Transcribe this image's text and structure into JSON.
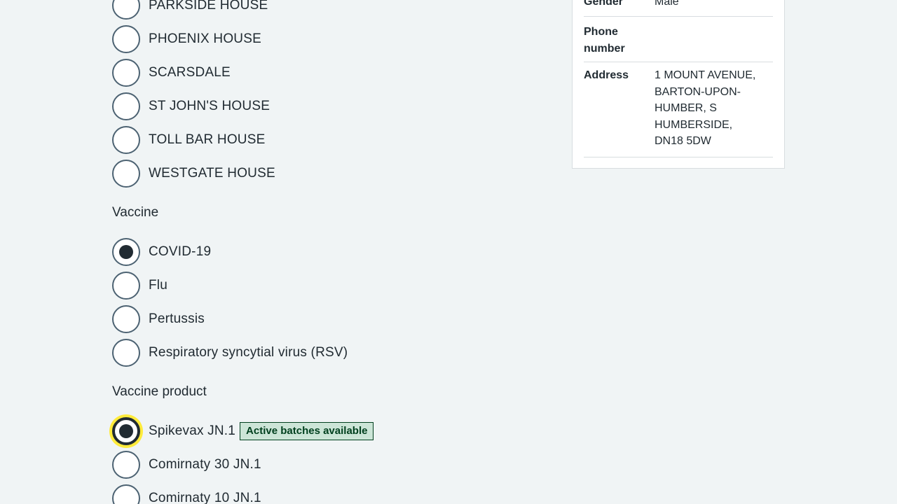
{
  "location_options": [
    {
      "label": "PARKSIDE HOUSE",
      "checked": false
    },
    {
      "label": "PHOENIX HOUSE",
      "checked": false
    },
    {
      "label": "SCARSDALE",
      "checked": false
    },
    {
      "label": "ST JOHN'S HOUSE",
      "checked": false
    },
    {
      "label": "TOLL BAR HOUSE",
      "checked": false
    },
    {
      "label": "WESTGATE HOUSE",
      "checked": false
    }
  ],
  "vaccine": {
    "legend": "Vaccine",
    "options": [
      {
        "label": "COVID-19",
        "checked": true
      },
      {
        "label": "Flu",
        "checked": false
      },
      {
        "label": "Pertussis",
        "checked": false
      },
      {
        "label": "Respiratory syncytial virus (RSV)",
        "checked": false
      }
    ]
  },
  "vaccine_product": {
    "legend": "Vaccine product",
    "options": [
      {
        "label": "Spikevax JN.1",
        "checked": true,
        "tag": "Active batches available"
      },
      {
        "label": "Comirnaty 30 JN.1",
        "checked": false
      },
      {
        "label": "Comirnaty 10 JN.1",
        "checked": false
      }
    ]
  },
  "patient_summary": {
    "gender_key": "Gender",
    "gender_value": "Male",
    "phone_key": "Phone number",
    "phone_value": "",
    "address_key": "Address",
    "address_value": "1 MOUNT AVENUE, BARTON-UPON-HUMBER, S HUMBERSIDE, DN18 5DW"
  },
  "colors": {
    "background": "#f0f4f5",
    "text": "#212b32",
    "radio_border": "#4c6272",
    "focus": "#ffeb3b",
    "tag_bg": "#cce5d7",
    "tag_text": "#00401e"
  }
}
